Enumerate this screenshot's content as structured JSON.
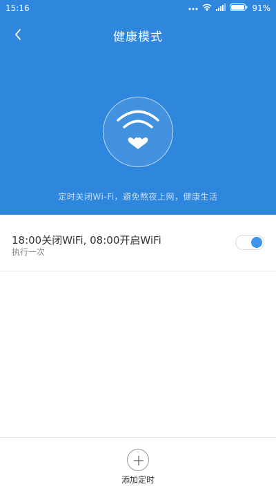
{
  "status_bar": {
    "time": "15:16",
    "battery": "91%",
    "icons": [
      "more-dots-icon",
      "wifi-icon",
      "signal-icon",
      "battery-icon"
    ]
  },
  "header": {
    "title": "健康模式",
    "back_icon": "chevron-left-icon",
    "caption": "定时关闭Wi-Fi，避免熬夜上网，健康生活",
    "hero_icon": "wifi-heart-icon"
  },
  "schedule": {
    "title": "18:00关闭WiFi, 08:00开启WiFi",
    "subtitle": "执行一次",
    "enabled": true
  },
  "footer": {
    "add_label": "添加定时",
    "add_icon": "plus-icon"
  },
  "colors": {
    "primary": "#2e86dd",
    "toggle_on": "#3e94e6"
  }
}
